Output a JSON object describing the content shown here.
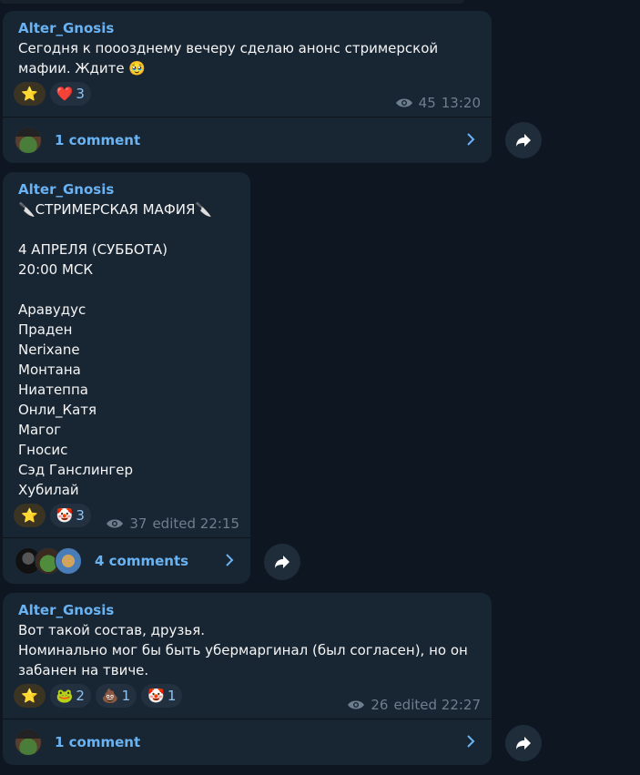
{
  "messages": [
    {
      "author": "Alter_Gnosis",
      "text": "Сегодня к пооозднему вечеру сделаю анонс стримерской мафии. Ждите 🥹",
      "reactions": [
        {
          "emoji": "⭐",
          "count": ""
        },
        {
          "emoji": "❤️",
          "count": "3"
        }
      ],
      "views": "45",
      "time": "13:20",
      "comments_label": "1 comment"
    },
    {
      "author": "Alter_Gnosis",
      "text": "🔪СТРИМЕРСКАЯ МАФИЯ🔪\n\n4 АПРЕЛЯ (СУББОТА)\n20:00 МСК\n\nАравудус\nПраден\nNerixane\nМонтана\nНиатеппа\nОнли_Катя\nМагог\nГносис\nСэд Ганслингер\nХубилай",
      "reactions": [
        {
          "emoji": "⭐",
          "count": ""
        },
        {
          "emoji": "🤡",
          "count": "3"
        }
      ],
      "views": "37",
      "time": "edited 22:15",
      "comments_label": "4 comments"
    },
    {
      "author": "Alter_Gnosis",
      "text": "Вот такой состав, друзья.\nНоминально мог бы быть убермаргинал (был согласен), но он забанен на твиче.",
      "reactions": [
        {
          "emoji": "⭐",
          "count": ""
        },
        {
          "emoji": "🐸",
          "count": "2"
        },
        {
          "emoji": "💩",
          "count": "1"
        },
        {
          "emoji": "🤡",
          "count": "1"
        }
      ],
      "views": "26",
      "time": "edited 22:27",
      "comments_label": "1 comment"
    }
  ],
  "colors": {
    "background": "#0e1621",
    "bubble": "#182533",
    "accent": "#6ab3f3",
    "meta": "#6d7f8f"
  }
}
